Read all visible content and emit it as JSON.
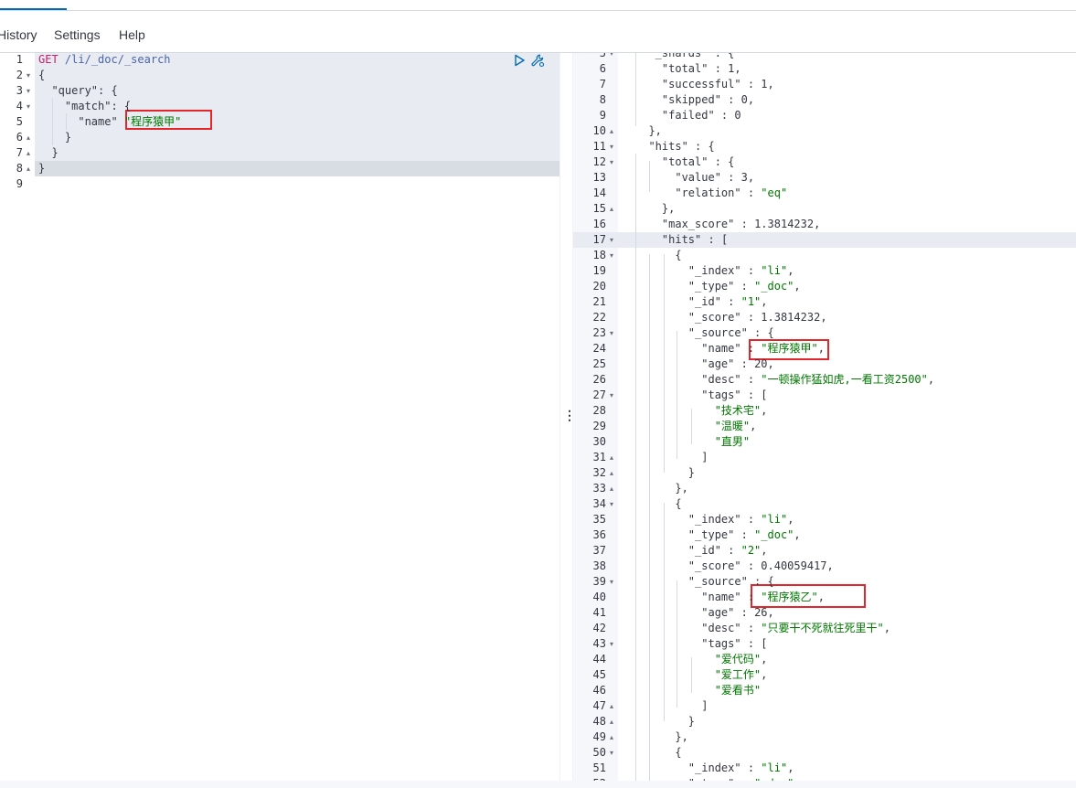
{
  "menu": {
    "history": "History",
    "settings": "Settings",
    "help": "Help"
  },
  "request": {
    "lines": [
      {
        "n": "1",
        "fold": "",
        "t": [
          [
            "m",
            "GET"
          ],
          [
            "k",
            " "
          ],
          [
            "u",
            "/li/_doc/_search"
          ]
        ]
      },
      {
        "n": "2",
        "fold": "▾",
        "t": [
          [
            "p",
            "{"
          ]
        ]
      },
      {
        "n": "3",
        "fold": "▾",
        "t": [
          [
            "p",
            "  "
          ],
          [
            "k",
            "\"query\""
          ],
          [
            "p",
            ": {"
          ]
        ]
      },
      {
        "n": "4",
        "fold": "▾",
        "t": [
          [
            "p",
            "    "
          ],
          [
            "k",
            "\"match\""
          ],
          [
            "p",
            ": {"
          ]
        ]
      },
      {
        "n": "5",
        "fold": "",
        "t": [
          [
            "p",
            "      "
          ],
          [
            "k",
            "\"name\""
          ],
          [
            "p",
            " "
          ],
          [
            "s",
            "\"程序猿甲\""
          ]
        ]
      },
      {
        "n": "6",
        "fold": "▴",
        "t": [
          [
            "p",
            "    }"
          ]
        ]
      },
      {
        "n": "7",
        "fold": "▴",
        "t": [
          [
            "p",
            "  }"
          ]
        ]
      },
      {
        "n": "8",
        "fold": "▴",
        "t": [
          [
            "p",
            "}"
          ]
        ]
      },
      {
        "n": "9",
        "fold": "",
        "t": []
      }
    ]
  },
  "response": {
    "lines": [
      {
        "n": "5",
        "fold": "▾",
        "t": [
          [
            "p",
            "  "
          ],
          [
            "k",
            "\"_shards\""
          ],
          [
            "p",
            " : {"
          ]
        ]
      },
      {
        "n": "6",
        "fold": "",
        "t": [
          [
            "p",
            "    "
          ],
          [
            "k",
            "\"total\""
          ],
          [
            "p",
            " : "
          ],
          [
            "n",
            "1"
          ],
          [
            "p",
            ","
          ]
        ]
      },
      {
        "n": "7",
        "fold": "",
        "t": [
          [
            "p",
            "    "
          ],
          [
            "k",
            "\"successful\""
          ],
          [
            "p",
            " : "
          ],
          [
            "n",
            "1"
          ],
          [
            "p",
            ","
          ]
        ]
      },
      {
        "n": "8",
        "fold": "",
        "t": [
          [
            "p",
            "    "
          ],
          [
            "k",
            "\"skipped\""
          ],
          [
            "p",
            " : "
          ],
          [
            "n",
            "0"
          ],
          [
            "p",
            ","
          ]
        ]
      },
      {
        "n": "9",
        "fold": "",
        "t": [
          [
            "p",
            "    "
          ],
          [
            "k",
            "\"failed\""
          ],
          [
            "p",
            " : "
          ],
          [
            "n",
            "0"
          ]
        ]
      },
      {
        "n": "10",
        "fold": "▴",
        "t": [
          [
            "p",
            "  },"
          ]
        ]
      },
      {
        "n": "11",
        "fold": "▾",
        "t": [
          [
            "p",
            "  "
          ],
          [
            "k",
            "\"hits\""
          ],
          [
            "p",
            " : {"
          ]
        ]
      },
      {
        "n": "12",
        "fold": "▾",
        "t": [
          [
            "p",
            "    "
          ],
          [
            "k",
            "\"total\""
          ],
          [
            "p",
            " : {"
          ]
        ]
      },
      {
        "n": "13",
        "fold": "",
        "t": [
          [
            "p",
            "      "
          ],
          [
            "k",
            "\"value\""
          ],
          [
            "p",
            " : "
          ],
          [
            "n",
            "3"
          ],
          [
            "p",
            ","
          ]
        ]
      },
      {
        "n": "14",
        "fold": "",
        "t": [
          [
            "p",
            "      "
          ],
          [
            "k",
            "\"relation\""
          ],
          [
            "p",
            " : "
          ],
          [
            "s",
            "\"eq\""
          ]
        ]
      },
      {
        "n": "15",
        "fold": "▴",
        "t": [
          [
            "p",
            "    },"
          ]
        ]
      },
      {
        "n": "16",
        "fold": "",
        "t": [
          [
            "p",
            "    "
          ],
          [
            "k",
            "\"max_score\""
          ],
          [
            "p",
            " : "
          ],
          [
            "n",
            "1.3814232"
          ],
          [
            "p",
            ","
          ]
        ]
      },
      {
        "n": "17",
        "fold": "▾",
        "t": [
          [
            "p",
            "    "
          ],
          [
            "k",
            "\"hits\""
          ],
          [
            "p",
            " : ["
          ]
        ]
      },
      {
        "n": "18",
        "fold": "▾",
        "t": [
          [
            "p",
            "      {"
          ]
        ]
      },
      {
        "n": "19",
        "fold": "",
        "t": [
          [
            "p",
            "        "
          ],
          [
            "k",
            "\"_index\""
          ],
          [
            "p",
            " : "
          ],
          [
            "s",
            "\"li\""
          ],
          [
            "p",
            ","
          ]
        ]
      },
      {
        "n": "20",
        "fold": "",
        "t": [
          [
            "p",
            "        "
          ],
          [
            "k",
            "\"_type\""
          ],
          [
            "p",
            " : "
          ],
          [
            "s",
            "\"_doc\""
          ],
          [
            "p",
            ","
          ]
        ]
      },
      {
        "n": "21",
        "fold": "",
        "t": [
          [
            "p",
            "        "
          ],
          [
            "k",
            "\"_id\""
          ],
          [
            "p",
            " : "
          ],
          [
            "s",
            "\"1\""
          ],
          [
            "p",
            ","
          ]
        ]
      },
      {
        "n": "22",
        "fold": "",
        "t": [
          [
            "p",
            "        "
          ],
          [
            "k",
            "\"_score\""
          ],
          [
            "p",
            " : "
          ],
          [
            "n",
            "1.3814232"
          ],
          [
            "p",
            ","
          ]
        ]
      },
      {
        "n": "23",
        "fold": "▾",
        "t": [
          [
            "p",
            "        "
          ],
          [
            "k",
            "\"_source\""
          ],
          [
            "p",
            " : {"
          ]
        ]
      },
      {
        "n": "24",
        "fold": "",
        "t": [
          [
            "p",
            "          "
          ],
          [
            "k",
            "\"name\""
          ],
          [
            "p",
            " : "
          ],
          [
            "s",
            "\"程序猿甲\""
          ],
          [
            "p",
            ","
          ]
        ]
      },
      {
        "n": "25",
        "fold": "",
        "t": [
          [
            "p",
            "          "
          ],
          [
            "k",
            "\"age\""
          ],
          [
            "p",
            " : "
          ],
          [
            "n",
            "20"
          ],
          [
            "p",
            ","
          ]
        ]
      },
      {
        "n": "26",
        "fold": "",
        "t": [
          [
            "p",
            "          "
          ],
          [
            "k",
            "\"desc\""
          ],
          [
            "p",
            " : "
          ],
          [
            "s",
            "\"一顿操作猛如虎,一看工资2500\""
          ],
          [
            "p",
            ","
          ]
        ]
      },
      {
        "n": "27",
        "fold": "▾",
        "t": [
          [
            "p",
            "          "
          ],
          [
            "k",
            "\"tags\""
          ],
          [
            "p",
            " : ["
          ]
        ]
      },
      {
        "n": "28",
        "fold": "",
        "t": [
          [
            "p",
            "            "
          ],
          [
            "s",
            "\"技术宅\""
          ],
          [
            "p",
            ","
          ]
        ]
      },
      {
        "n": "29",
        "fold": "",
        "t": [
          [
            "p",
            "            "
          ],
          [
            "s",
            "\"温暖\""
          ],
          [
            "p",
            ","
          ]
        ]
      },
      {
        "n": "30",
        "fold": "",
        "t": [
          [
            "p",
            "            "
          ],
          [
            "s",
            "\"直男\""
          ]
        ]
      },
      {
        "n": "31",
        "fold": "▴",
        "t": [
          [
            "p",
            "          ]"
          ]
        ]
      },
      {
        "n": "32",
        "fold": "▴",
        "t": [
          [
            "p",
            "        }"
          ]
        ]
      },
      {
        "n": "33",
        "fold": "▴",
        "t": [
          [
            "p",
            "      },"
          ]
        ]
      },
      {
        "n": "34",
        "fold": "▾",
        "t": [
          [
            "p",
            "      {"
          ]
        ]
      },
      {
        "n": "35",
        "fold": "",
        "t": [
          [
            "p",
            "        "
          ],
          [
            "k",
            "\"_index\""
          ],
          [
            "p",
            " : "
          ],
          [
            "s",
            "\"li\""
          ],
          [
            "p",
            ","
          ]
        ]
      },
      {
        "n": "36",
        "fold": "",
        "t": [
          [
            "p",
            "        "
          ],
          [
            "k",
            "\"_type\""
          ],
          [
            "p",
            " : "
          ],
          [
            "s",
            "\"_doc\""
          ],
          [
            "p",
            ","
          ]
        ]
      },
      {
        "n": "37",
        "fold": "",
        "t": [
          [
            "p",
            "        "
          ],
          [
            "k",
            "\"_id\""
          ],
          [
            "p",
            " : "
          ],
          [
            "s",
            "\"2\""
          ],
          [
            "p",
            ","
          ]
        ]
      },
      {
        "n": "38",
        "fold": "",
        "t": [
          [
            "p",
            "        "
          ],
          [
            "k",
            "\"_score\""
          ],
          [
            "p",
            " : "
          ],
          [
            "n",
            "0.40059417"
          ],
          [
            "p",
            ","
          ]
        ]
      },
      {
        "n": "39",
        "fold": "▾",
        "t": [
          [
            "p",
            "        "
          ],
          [
            "k",
            "\"_source\""
          ],
          [
            "p",
            " : {"
          ]
        ]
      },
      {
        "n": "40",
        "fold": "",
        "t": [
          [
            "p",
            "          "
          ],
          [
            "k",
            "\"name\""
          ],
          [
            "p",
            " : "
          ],
          [
            "s",
            "\"程序猿乙\""
          ],
          [
            "p",
            ","
          ]
        ]
      },
      {
        "n": "41",
        "fold": "",
        "t": [
          [
            "p",
            "          "
          ],
          [
            "k",
            "\"age\""
          ],
          [
            "p",
            " : "
          ],
          [
            "n",
            "26"
          ],
          [
            "p",
            ","
          ]
        ]
      },
      {
        "n": "42",
        "fold": "",
        "t": [
          [
            "p",
            "          "
          ],
          [
            "k",
            "\"desc\""
          ],
          [
            "p",
            " : "
          ],
          [
            "s",
            "\"只要干不死就往死里干\""
          ],
          [
            "p",
            ","
          ]
        ]
      },
      {
        "n": "43",
        "fold": "▾",
        "t": [
          [
            "p",
            "          "
          ],
          [
            "k",
            "\"tags\""
          ],
          [
            "p",
            " : ["
          ]
        ]
      },
      {
        "n": "44",
        "fold": "",
        "t": [
          [
            "p",
            "            "
          ],
          [
            "s",
            "\"爱代码\""
          ],
          [
            "p",
            ","
          ]
        ]
      },
      {
        "n": "45",
        "fold": "",
        "t": [
          [
            "p",
            "            "
          ],
          [
            "s",
            "\"爱工作\""
          ],
          [
            "p",
            ","
          ]
        ]
      },
      {
        "n": "46",
        "fold": "",
        "t": [
          [
            "p",
            "            "
          ],
          [
            "s",
            "\"爱看书\""
          ]
        ]
      },
      {
        "n": "47",
        "fold": "▴",
        "t": [
          [
            "p",
            "          ]"
          ]
        ]
      },
      {
        "n": "48",
        "fold": "▴",
        "t": [
          [
            "p",
            "        }"
          ]
        ]
      },
      {
        "n": "49",
        "fold": "▴",
        "t": [
          [
            "p",
            "      },"
          ]
        ]
      },
      {
        "n": "50",
        "fold": "▾",
        "t": [
          [
            "p",
            "      {"
          ]
        ]
      },
      {
        "n": "51",
        "fold": "",
        "t": [
          [
            "p",
            "        "
          ],
          [
            "k",
            "\"_index\""
          ],
          [
            "p",
            " : "
          ],
          [
            "s",
            "\"li\""
          ],
          [
            "p",
            ","
          ]
        ]
      },
      {
        "n": "52",
        "fold": "",
        "t": [
          [
            "p",
            "        "
          ],
          [
            "k",
            "\"_type\""
          ],
          [
            "p",
            " : "
          ],
          [
            "s",
            "\"_doc\""
          ],
          [
            "p",
            ","
          ]
        ]
      }
    ]
  },
  "icons": {
    "run": "play-icon",
    "settings": "wrench-icon",
    "resize": "vertical-dots-icon"
  },
  "colors": {
    "string": "#007800",
    "method": "#c3206d",
    "url": "#4a65a8",
    "highlight_box": "#e3262b"
  }
}
